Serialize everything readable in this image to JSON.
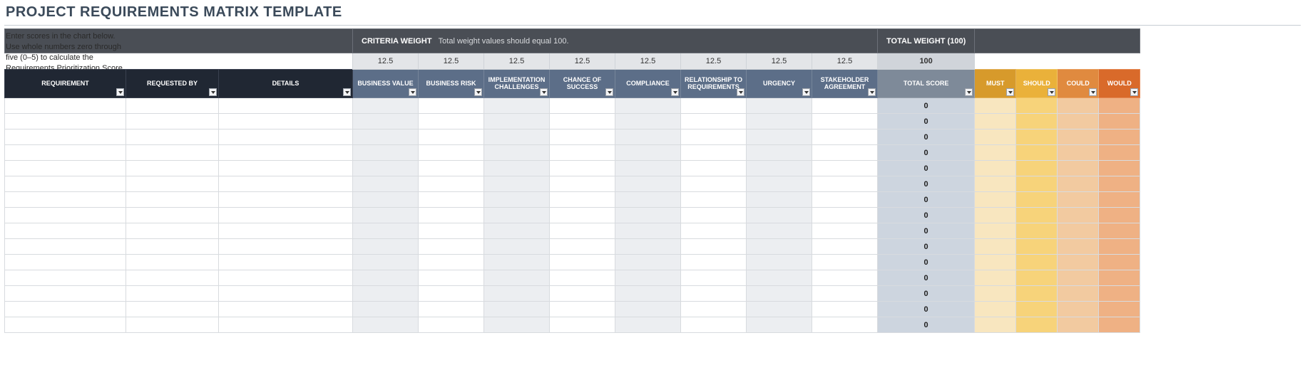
{
  "title": "PROJECT REQUIREMENTS MATRIX TEMPLATE",
  "instructions_l1": "Enter scores in the chart below.",
  "instructions_l2": "Use whole numbers zero through",
  "instructions_l3": "five (0–5) to calculate the",
  "instructions_l4": "Requirements Prioritization Score.",
  "banner": {
    "label": "CRITERIA WEIGHT",
    "desc": "Total weight values should equal 100.",
    "total_weight_label": "TOTAL WEIGHT (100)"
  },
  "weights": {
    "values": [
      "12.5",
      "12.5",
      "12.5",
      "12.5",
      "12.5",
      "12.5",
      "12.5",
      "12.5"
    ],
    "sum": "100"
  },
  "headers": {
    "requirement": "REQUIREMENT",
    "requested_by": "REQUESTED BY",
    "details": "DETAILS",
    "criteria": [
      "BUSINESS VALUE",
      "BUSINESS RISK",
      "IMPLEMENTATION CHALLENGES",
      "CHANCE OF SUCCESS",
      "COMPLIANCE",
      "RELATIONSHIP TO REQUIREMENTS",
      "URGENCY",
      "STAKEHOLDER AGREEMENT"
    ],
    "total_score": "TOTAL SCORE",
    "moscow": {
      "must": "MUST",
      "should": "SHOULD",
      "could": "COULD",
      "would": "WOULD"
    }
  },
  "rows": [
    {
      "total": "0"
    },
    {
      "total": "0"
    },
    {
      "total": "0"
    },
    {
      "total": "0"
    },
    {
      "total": "0"
    },
    {
      "total": "0"
    },
    {
      "total": "0"
    },
    {
      "total": "0"
    },
    {
      "total": "0"
    },
    {
      "total": "0"
    },
    {
      "total": "0"
    },
    {
      "total": "0"
    },
    {
      "total": "0"
    },
    {
      "total": "0"
    },
    {
      "total": "0"
    }
  ]
}
